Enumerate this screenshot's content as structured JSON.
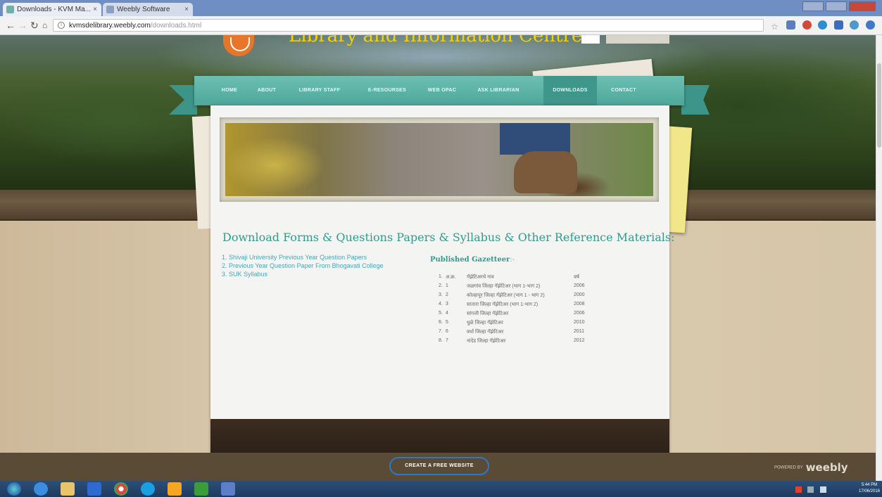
{
  "browser": {
    "tabs": [
      {
        "label": "Downloads - KVM Ma..."
      },
      {
        "label": "Weebly Software"
      }
    ],
    "url_host": "kvmsdelibrary.weebly.com",
    "url_path": "/downloads.html"
  },
  "site": {
    "title": "Library and Information Centre"
  },
  "nav": {
    "items": [
      "HOME",
      "ABOUT",
      "LIBRARY STAFF",
      "E-RESOURSES",
      "WEB OPAC",
      "ASK LIBRARIAN",
      "DOWNLOADS",
      "CONTACT"
    ],
    "active": "DOWNLOADS"
  },
  "content": {
    "heading": "Download Forms & Questions Papers & Syllabus & Other Reference Materials:",
    "links": [
      "1. Shivaji University Previous Year Question Papers",
      "2. Previous Year Question Paper From Bhogavati College",
      "3. SUK Syllabus"
    ],
    "gazetteer_title": "Published Gazetteer",
    "gazetteer_arrow": ":-",
    "gazetteer_header": {
      "no": "1.",
      "sr": "अ.क्र.",
      "name": "गॅझेटिअरचे नाव",
      "year": "वर्ष"
    },
    "gazetteer_rows": [
      {
        "no": "2.",
        "sr": "1",
        "name": "जळगांव जिल्हा गॅझेटिअर (भाग 1-भाग 2)",
        "year": "2006"
      },
      {
        "no": "3.",
        "sr": "2",
        "name": "कोल्हापूर जिल्हा गॅझेटिअर (भाग 1 - भाग 2)",
        "year": "2000"
      },
      {
        "no": "4.",
        "sr": "3",
        "name": "सातारा जिल्हा गॅझेटिअर (भाग 1-भाग 2)",
        "year": "2008"
      },
      {
        "no": "5.",
        "sr": "4",
        "name": "सांगली जिल्हा गॅझेटिअर",
        "year": "2006"
      },
      {
        "no": "6.",
        "sr": "5",
        "name": "धुळे जिल्हा गॅझेटिअर",
        "year": "2010"
      },
      {
        "no": "7.",
        "sr": "6",
        "name": "वर्धा जिल्हा गॅझेटिअर",
        "year": "2011"
      },
      {
        "no": "8.",
        "sr": "7",
        "name": "नांदेड जिल्हा गॅझेटिअर",
        "year": "2012"
      }
    ]
  },
  "footer": {
    "create_button": "CREATE A FREE WEBSITE",
    "powered_by": "POWERED BY",
    "brand": "weebly"
  },
  "taskbar": {
    "time": "5:44 PM",
    "date": "17/06/2016"
  },
  "colors": {
    "nav_bg": "#4da79a",
    "heading": "#2f9d8a",
    "link": "#4aa6b8",
    "create_button_border": "#2c79c4"
  }
}
